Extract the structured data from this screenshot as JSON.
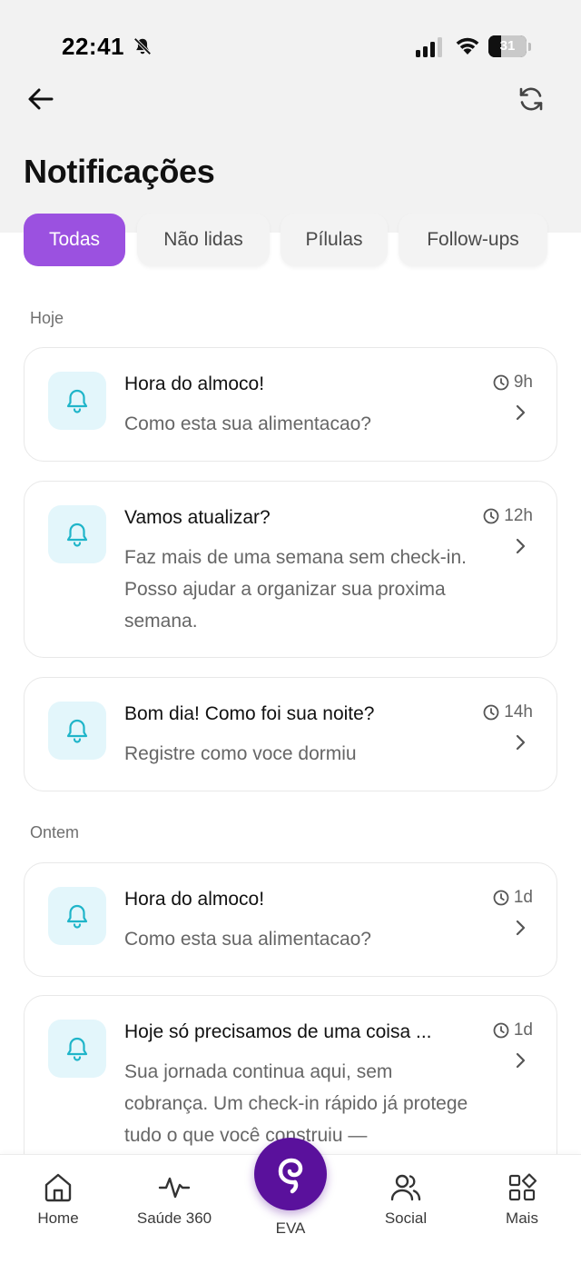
{
  "status_bar": {
    "time": "22:41",
    "battery": "31",
    "battery_level": 0.31
  },
  "header": {
    "title": "Notificações"
  },
  "tabs": [
    {
      "label": "Todas",
      "active": true
    },
    {
      "label": "Não lidas",
      "active": false
    },
    {
      "label": "Pílulas",
      "active": false
    },
    {
      "label": "Follow-ups",
      "active": false
    }
  ],
  "sections": [
    {
      "label": "Hoje",
      "items": [
        {
          "title": "Hora do almoco!",
          "body": "Como esta sua alimentacao?",
          "time": "9h"
        },
        {
          "title": "Vamos atualizar?",
          "body": "Faz mais de uma semana sem check-in. Posso ajudar a organizar sua proxima semana.",
          "time": "12h"
        },
        {
          "title": "Bom dia! Como foi sua noite?",
          "body": "Registre como voce dormiu",
          "time": "14h"
        }
      ]
    },
    {
      "label": "Ontem",
      "items": [
        {
          "title": "Hora do almoco!",
          "body": "Como esta sua alimentacao?",
          "time": "1d"
        },
        {
          "title": "Hoje só precisamos de uma coisa ...",
          "body": "Sua jornada continua aqui, sem cobrança. Um check-in rápido já protege tudo o que você construiu —",
          "time": "1d"
        }
      ]
    }
  ],
  "bottom_nav": {
    "items": [
      {
        "label": "Home",
        "icon": "home-icon"
      },
      {
        "label": "Saúde 360",
        "icon": "activity-icon"
      },
      {
        "label": "EVA",
        "icon": "eva-logo"
      },
      {
        "label": "Social",
        "icon": "users-icon"
      },
      {
        "label": "Mais",
        "icon": "grid-icon"
      }
    ]
  },
  "colors": {
    "accent": "#9b51e0",
    "eva": "#5a119c",
    "icon_bg": "#e3f6fb",
    "icon": "#1fb5c9"
  }
}
